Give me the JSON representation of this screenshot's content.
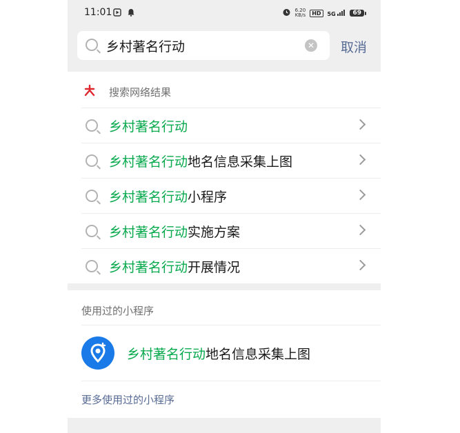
{
  "status_bar": {
    "time": "11:01",
    "net_speed_value": "6.20",
    "net_speed_unit": "KB/s",
    "hd_label": "HD",
    "network": "5G",
    "battery": "69"
  },
  "search": {
    "query": "乡村著名行动",
    "cancel_label": "取消"
  },
  "web_results": {
    "title": "搜索网络结果",
    "logo_color": "#e0262d",
    "suggestions": [
      {
        "highlight": "乡村著名行动",
        "suffix": ""
      },
      {
        "highlight": "乡村著名行动",
        "suffix": "地名信息采集上图"
      },
      {
        "highlight": "乡村著名行动",
        "suffix": "小程序"
      },
      {
        "highlight": "乡村著名行动",
        "suffix": "实施方案"
      },
      {
        "highlight": "乡村著名行动",
        "suffix": "开展情况"
      }
    ]
  },
  "mini_programs": {
    "title": "使用过的小程序",
    "items": [
      {
        "highlight": "乡村著名行动",
        "suffix": "地名信息采集上图",
        "icon": "map-pin-plus-icon"
      }
    ],
    "more_label": "更多使用过的小程序"
  },
  "colors": {
    "highlight": "#07a94d",
    "link": "#576b95",
    "mini_program_icon": "#1a7be8",
    "band": "#efefef"
  }
}
